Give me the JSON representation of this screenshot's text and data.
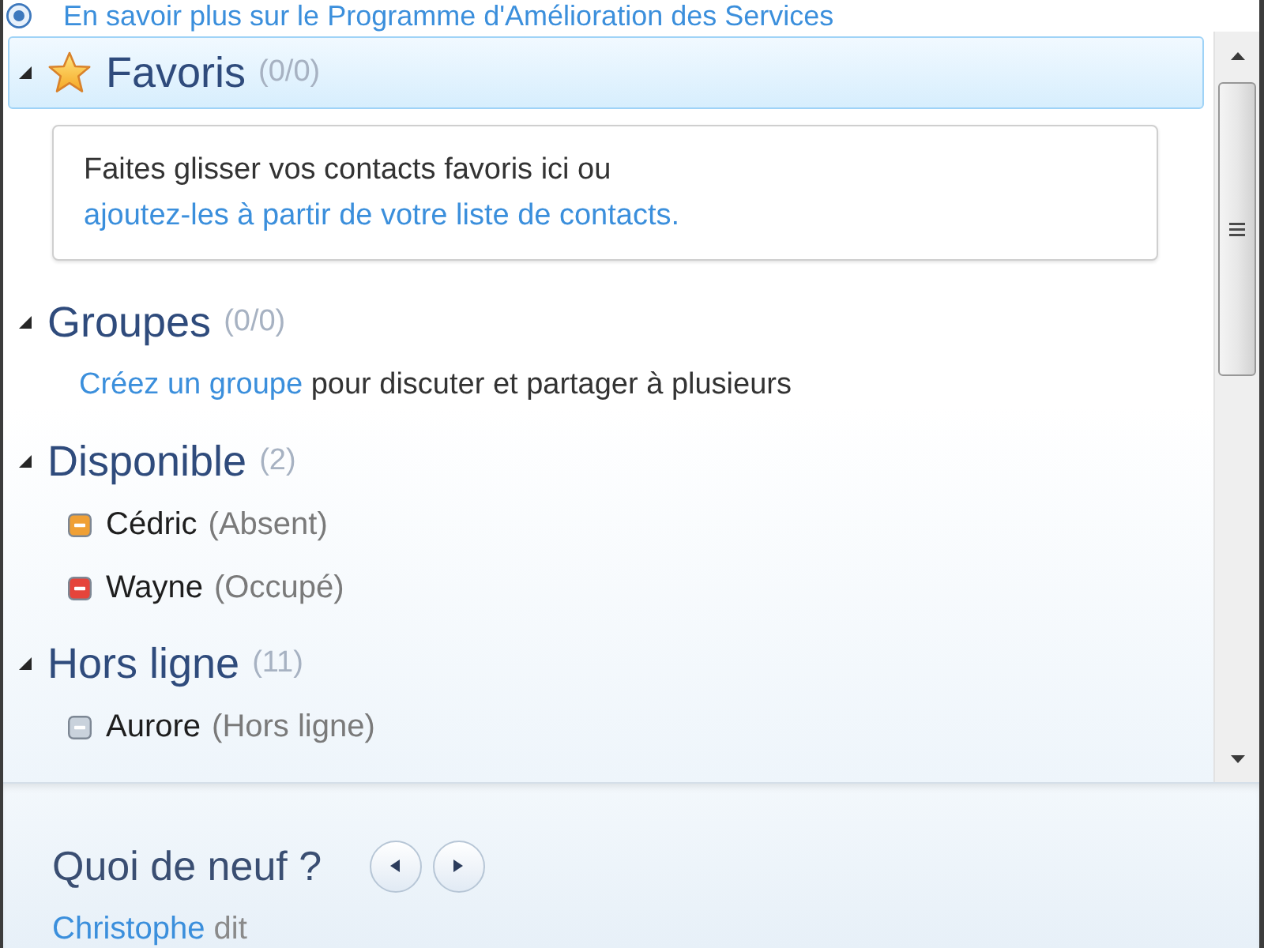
{
  "info_link": {
    "text": "En savoir plus sur le Programme d'Amélioration des Services"
  },
  "groups": [
    {
      "kind": "favorites",
      "title": "Favoris",
      "count": "(0/0)",
      "expanded": true,
      "selected": true,
      "hint": {
        "text": "Faites glisser vos contacts favoris ici ou",
        "link": "ajoutez-les à partir de votre liste de contacts."
      }
    },
    {
      "kind": "prompt",
      "title": "Groupes",
      "count": "(0/0)",
      "expanded": true,
      "selected": false,
      "prompt": {
        "link": "Créez un groupe",
        "text": "pour discuter et partager à plusieurs"
      }
    },
    {
      "kind": "contacts",
      "title": "Disponible",
      "count": "(2)",
      "expanded": true,
      "selected": false,
      "contacts": [
        {
          "name": "Cédric",
          "status": "(Absent)",
          "color": "#f0a035"
        },
        {
          "name": "Wayne",
          "status": "(Occupé)",
          "color": "#e5443b"
        }
      ]
    },
    {
      "kind": "contacts",
      "title": "Hors ligne",
      "count": "(11)",
      "expanded": true,
      "selected": false,
      "contacts": [
        {
          "name": "Aurore",
          "status": "(Hors ligne)",
          "color": "#c9d2dc"
        }
      ]
    }
  ],
  "whats_new": {
    "title": "Quoi de neuf ?",
    "author": "Christophe",
    "verb": "dit"
  }
}
